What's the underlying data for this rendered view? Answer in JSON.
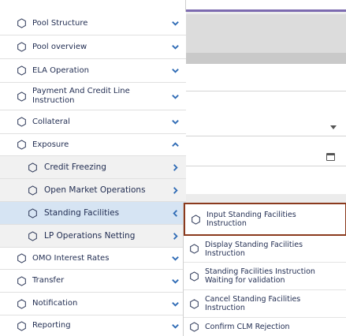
{
  "sidebar": {
    "items": [
      {
        "label": "Pool Structure",
        "chevron": "down"
      },
      {
        "label": "Pool overview",
        "chevron": "down"
      },
      {
        "label": "ELA Operation",
        "chevron": "down"
      },
      {
        "label": "Payment And Credit Line Instruction",
        "chevron": "down"
      },
      {
        "label": "Collateral",
        "chevron": "down"
      },
      {
        "label": "Exposure",
        "chevron": "up"
      },
      {
        "label": "Credit Freezing",
        "chevron": "right"
      },
      {
        "label": "Open Market Operations",
        "chevron": "right"
      },
      {
        "label": "Standing Facilities",
        "chevron": "left"
      },
      {
        "label": "LP Operations Netting",
        "chevron": "right"
      },
      {
        "label": "OMO Interest Rates",
        "chevron": "down"
      },
      {
        "label": "Transfer",
        "chevron": "down"
      },
      {
        "label": "Notification",
        "chevron": "down"
      },
      {
        "label": "Reporting",
        "chevron": "down"
      }
    ]
  },
  "submenu": {
    "items": [
      {
        "label": "Input Standing Facilities Instruction"
      },
      {
        "label": "Display Standing Facilities Instruction"
      },
      {
        "label": "Standing Facilities Instruction Waiting for validation"
      },
      {
        "label": "Cancel Standing Facilities Instruction"
      },
      {
        "label": "Confirm CLM Rejection"
      }
    ]
  },
  "colors": {
    "text": "#1f2b50",
    "chevron": "#2f6bb5",
    "active_bg": "#d6e4f3",
    "sub_bg": "#f1f1f1",
    "highlight_border": "#8b3a1e",
    "accent_line": "#7d6bb0"
  },
  "icons": {
    "menu_item": "hexagon-outline-icon",
    "expand": "chevron-icon",
    "date": "calendar-icon",
    "select": "caret-down-icon"
  }
}
